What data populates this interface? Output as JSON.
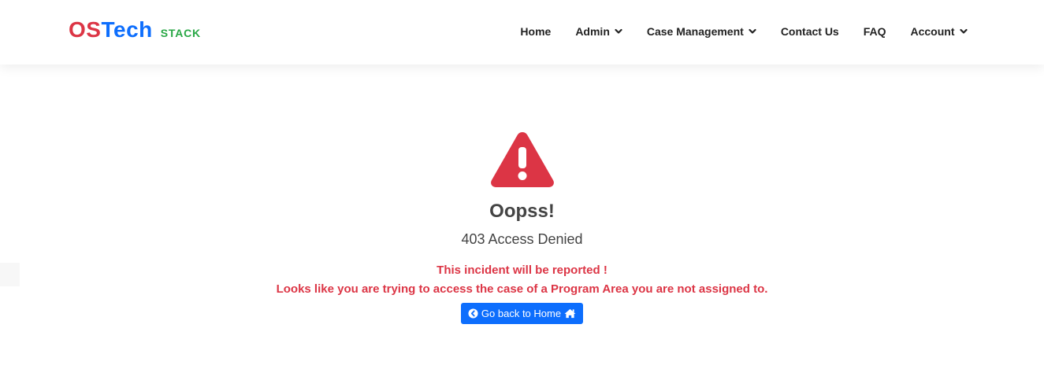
{
  "brand": {
    "os": "OS",
    "tech": "Tech",
    "stack": "STACK"
  },
  "nav": {
    "items": [
      {
        "label": "Home",
        "dropdown": false
      },
      {
        "label": "Admin",
        "dropdown": true
      },
      {
        "label": "Case Management",
        "dropdown": true
      },
      {
        "label": "Contact Us",
        "dropdown": false
      },
      {
        "label": "FAQ",
        "dropdown": false
      },
      {
        "label": "Account",
        "dropdown": true
      }
    ]
  },
  "error": {
    "icon": "warning-triangle-icon",
    "title": "Oopss!",
    "subtitle": "403 Access Denied",
    "message1": "This incident will be reported !",
    "message2": "Looks like you are trying to access the case of a Program Area you are not assigned to.",
    "button_label": "Go back to Home"
  },
  "colors": {
    "danger": "#dc3545",
    "primary": "#0d6efd",
    "success": "#28a745"
  }
}
